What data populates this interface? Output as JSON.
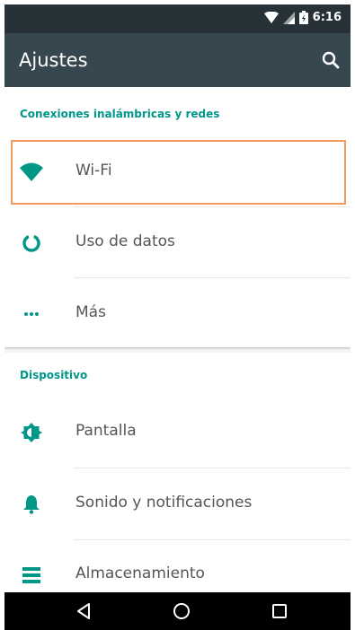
{
  "status_bar": {
    "time": "6:16"
  },
  "app_bar": {
    "title": "Ajustes"
  },
  "sections": [
    {
      "header": "Conexiones inalámbricas y redes",
      "items": [
        {
          "label": "Wi-Fi",
          "icon": "wifi-icon"
        },
        {
          "label": "Uso de datos",
          "icon": "data-usage-icon"
        },
        {
          "label": "Más",
          "icon": "more-icon"
        }
      ]
    },
    {
      "header": "Dispositivo",
      "items": [
        {
          "label": "Pantalla",
          "icon": "brightness-icon"
        },
        {
          "label": "Sonido y notificaciones",
          "icon": "bell-icon"
        },
        {
          "label": "Almacenamiento",
          "icon": "storage-icon"
        }
      ]
    }
  ],
  "colors": {
    "status_bar": "#263238",
    "app_bar": "#37474f",
    "accent": "#009688",
    "highlight": "#f09a5f"
  }
}
